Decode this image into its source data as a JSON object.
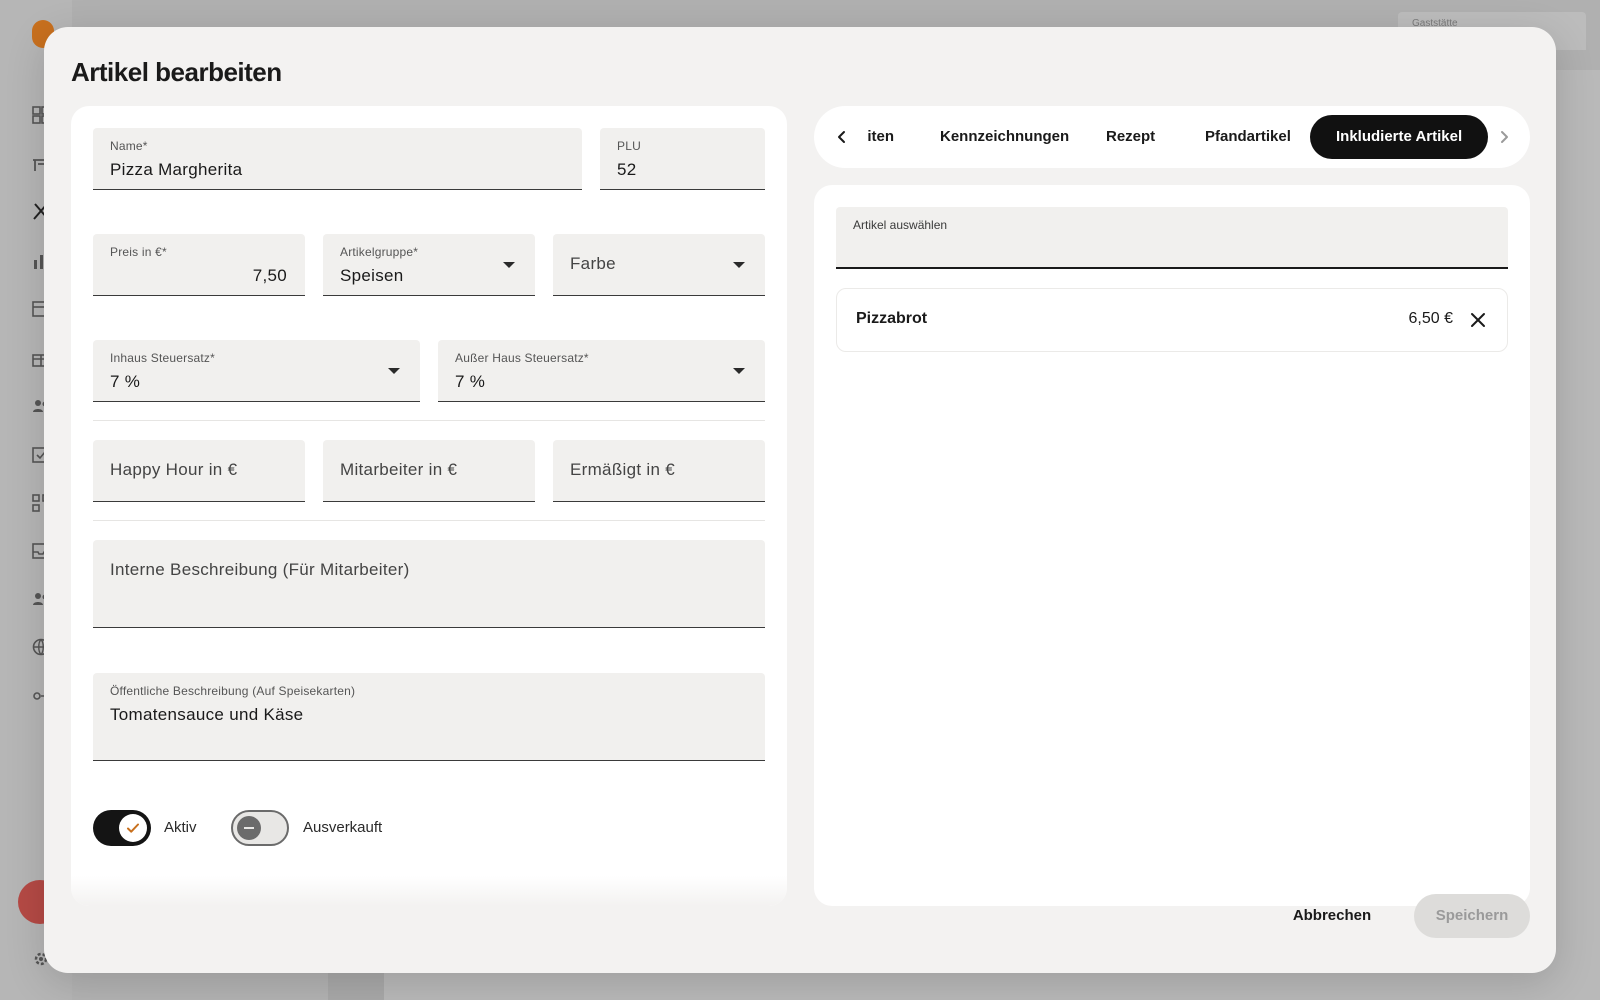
{
  "background": {
    "topbar": {
      "venue_label": "Gaststätte"
    }
  },
  "dialog": {
    "title": "Artikel bearbeiten",
    "form": {
      "name": {
        "label": "Name*",
        "value": "Pizza Margherita"
      },
      "plu": {
        "label": "PLU",
        "value": "52"
      },
      "price": {
        "label": "Preis in €*",
        "value": "7,50"
      },
      "group": {
        "label": "Artikelgruppe*",
        "value": "Speisen"
      },
      "color": {
        "placeholder": "Farbe"
      },
      "tax_in": {
        "label": "Inhaus Steuersatz*",
        "value": "7 %"
      },
      "tax_out": {
        "label": "Außer Haus Steuersatz*",
        "value": "7 %"
      },
      "happy_hour": {
        "placeholder": "Happy Hour in €"
      },
      "staff": {
        "placeholder": "Mitarbeiter in €"
      },
      "reduced": {
        "placeholder": "Ermäßigt in €"
      },
      "internal_desc": {
        "placeholder": "Interne Beschreibung (Für Mitarbeiter)"
      },
      "public_desc": {
        "label": "Öffentliche Beschreibung (Auf Speisekarten)",
        "value": "Tomatensauce und Käse"
      },
      "active": {
        "label": "Aktiv",
        "on": true
      },
      "soldout": {
        "label": "Ausverkauft",
        "on": false
      }
    },
    "tabs": {
      "partial": "iten",
      "items": [
        "Kennzeichnungen",
        "Rezept",
        "Pfandartikel",
        "Inkludierte Artikel"
      ],
      "active": "Inkludierte Artikel"
    },
    "included": {
      "select_label": "Artikel auswählen",
      "items": [
        {
          "name": "Pizzabrot",
          "price": "6,50 €"
        }
      ]
    },
    "actions": {
      "cancel": "Abbrechen",
      "save": "Speichern"
    }
  },
  "colors": {
    "accent": "#111111",
    "surface": "#f3f2f1",
    "field": "#f1f0ee",
    "logo": "#c8701e",
    "fab": "#b54a45"
  }
}
